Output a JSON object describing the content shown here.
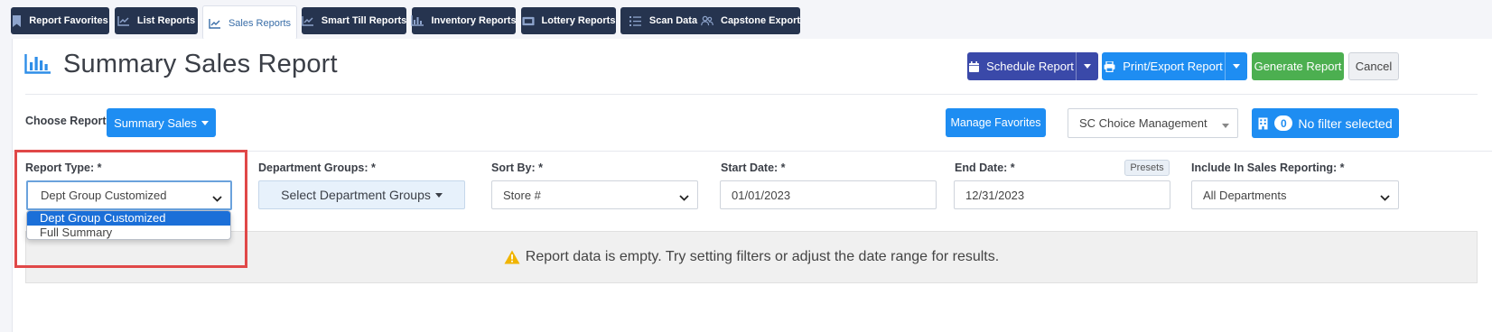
{
  "tabs": [
    {
      "label": "Report Favorites",
      "icon": "bookmark-icon"
    },
    {
      "label": "List Reports",
      "icon": "line-chart-icon"
    },
    {
      "label": "Sales Reports",
      "icon": "line-chart-icon"
    },
    {
      "label": "Smart Till Reports",
      "icon": "line-chart-icon"
    },
    {
      "label": "Inventory Reports",
      "icon": "bar-chart-icon"
    },
    {
      "label": "Lottery Reports",
      "icon": "ticket-icon"
    },
    {
      "label": "Scan Data",
      "icon": "list-icon"
    },
    {
      "label": "Capstone Export",
      "icon": "users-icon"
    }
  ],
  "active_tab": "Sales Reports",
  "page": {
    "title": "Summary Sales Report",
    "title_icon": "bar-chart-icon"
  },
  "actions": {
    "schedule": "Schedule Report",
    "print_export": "Print/Export Report",
    "generate": "Generate Report",
    "cancel": "Cancel"
  },
  "choose": {
    "label": "Choose Report",
    "value": "Summary Sales"
  },
  "manage_favorites": "Manage Favorites",
  "store_select": "SC Choice Management",
  "filter": {
    "count": "0",
    "label": "No filter selected"
  },
  "filters": {
    "report_type": {
      "label": "Report Type: *",
      "value": "Dept Group Customized",
      "options": [
        "Dept Group Customized",
        "Full Summary"
      ]
    },
    "dept_groups": {
      "label": "Department Groups: *",
      "value": "Select Department Groups"
    },
    "sort_by": {
      "label": "Sort By: *",
      "value": "Store #"
    },
    "start_date": {
      "label": "Start Date: *",
      "value": "01/01/2023"
    },
    "end_date": {
      "label": "End Date: *",
      "value": "12/31/2023",
      "presets": "Presets"
    },
    "include": {
      "label": "Include In Sales Reporting: *",
      "value": "All Departments"
    }
  },
  "empty_message": "Report data is empty. Try setting filters or adjust the date range for results.",
  "colors": {
    "nav": "#26344f",
    "schedule": "#3a49a9",
    "primary": "#1e8df2",
    "generate": "#4caf50",
    "highlight": "#e04848"
  }
}
